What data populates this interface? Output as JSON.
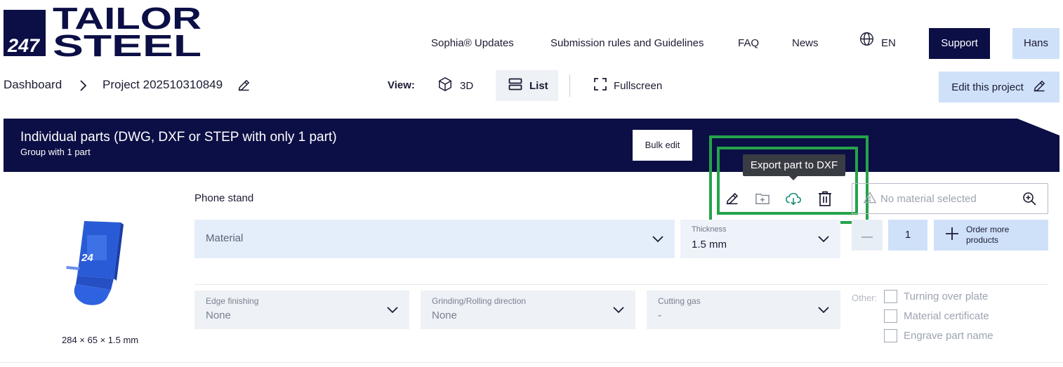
{
  "logo": {
    "number": "247",
    "line1": "TAILOR",
    "line2": "STEEL"
  },
  "nav": {
    "links": [
      "Sophia® Updates",
      "Submission rules and Guidelines",
      "FAQ",
      "News"
    ],
    "language": "EN",
    "support_label": "Support",
    "user_label": "Hans"
  },
  "breadcrumb": {
    "root": "Dashboard",
    "project": "Project 202510310849"
  },
  "view": {
    "label": "View:",
    "option_3d": "3D",
    "option_list": "List",
    "fullscreen": "Fullscreen",
    "selected": "List"
  },
  "edit_project_label": "Edit this project",
  "group": {
    "title": "Individual parts (DWG, DXF or STEP with only 1 part)",
    "subtitle": "Group with 1 part",
    "bulk_edit_label": "Bulk edit"
  },
  "part": {
    "name": "Phone stand",
    "dimensions": "284 × 65 × 1.5 mm",
    "tooltip": "Export part to DXF",
    "material_status": "No material selected",
    "material_placeholder": "Material",
    "thickness_label": "Thickness",
    "thickness_value": "1.5 mm",
    "quantity": "1",
    "order_more_label": "Order more products",
    "options": [
      {
        "label": "Edge finishing",
        "value": "None"
      },
      {
        "label": "Grinding/Rolling direction",
        "value": "None"
      },
      {
        "label": "Cutting gas",
        "value": "-"
      }
    ],
    "other_label": "Other:",
    "checkboxes": [
      "Turning over plate",
      "Material certificate",
      "Engrave part name"
    ]
  },
  "colors": {
    "navy": "#0c0f45",
    "light_blue": "#cfe1f8",
    "highlight_green": "#25a34a",
    "part_blue": "#2a5bd7"
  }
}
